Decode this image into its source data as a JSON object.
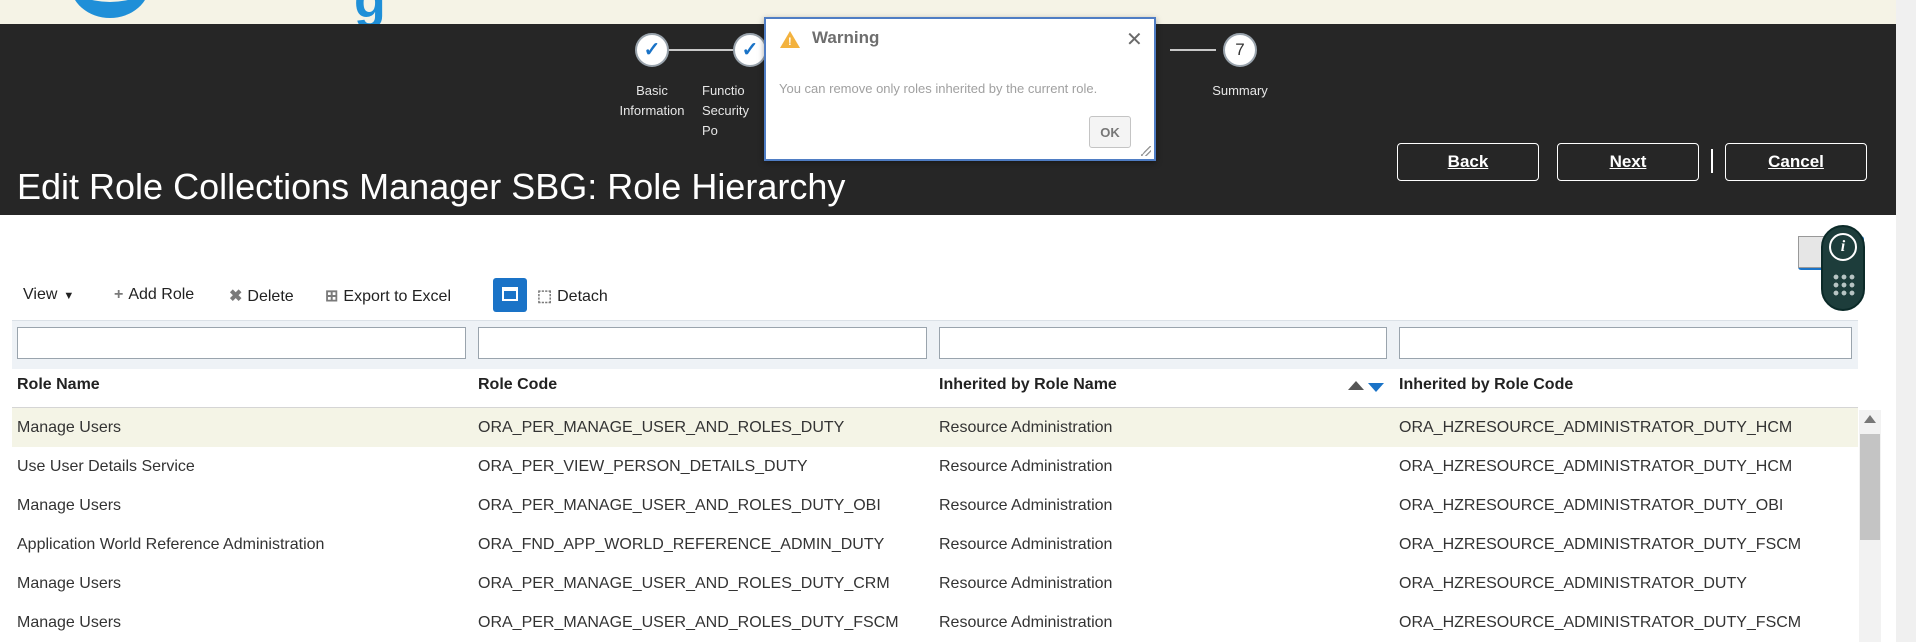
{
  "train": {
    "steps": [
      {
        "label_lines": [
          "Basic",
          "Information"
        ],
        "state": "done"
      },
      {
        "label_lines": [
          "Functio",
          "Security Po"
        ],
        "state": "done"
      },
      {
        "number": "7",
        "label_lines": [
          "Summary"
        ],
        "state": "pending"
      }
    ],
    "check_glyph": "✓"
  },
  "page": {
    "title": "Edit Role Collections Manager SBG: Role Hierarchy"
  },
  "header_buttons": {
    "back": "Back",
    "next": "Next",
    "cancel": "Cancel"
  },
  "dialog": {
    "title": "Warning",
    "message": "You can remove only roles inherited by the current role.",
    "ok_label": "OK",
    "close_glyph": "✕",
    "warn_glyph": "!"
  },
  "toolbar": {
    "view_label": "View",
    "view_caret": "▼",
    "add_role_label": "Add Role",
    "add_icon": "+",
    "delete_label": "Delete",
    "delete_icon": "✖",
    "export_label": "Export to Excel",
    "export_icon": "⊞",
    "detach_label": "Detach",
    "detach_icon": "⬚"
  },
  "assistant": {
    "info_glyph": "i"
  },
  "table": {
    "columns": [
      "Role Name",
      "Role Code",
      "Inherited by Role Name",
      "Inherited by Role Code"
    ],
    "rows": [
      [
        "Manage Users",
        "ORA_PER_MANAGE_USER_AND_ROLES_DUTY",
        "Resource Administration",
        "ORA_HZRESOURCE_ADMINISTRATOR_DUTY_HCM"
      ],
      [
        "Use User Details Service",
        "ORA_PER_VIEW_PERSON_DETAILS_DUTY",
        "Resource Administration",
        "ORA_HZRESOURCE_ADMINISTRATOR_DUTY_HCM"
      ],
      [
        "Manage Users",
        "ORA_PER_MANAGE_USER_AND_ROLES_DUTY_OBI",
        "Resource Administration",
        "ORA_HZRESOURCE_ADMINISTRATOR_DUTY_OBI"
      ],
      [
        "Application World Reference Administration",
        "ORA_FND_APP_WORLD_REFERENCE_ADMIN_DUTY",
        "Resource Administration",
        "ORA_HZRESOURCE_ADMINISTRATOR_DUTY_FSCM"
      ],
      [
        "Manage Users",
        "ORA_PER_MANAGE_USER_AND_ROLES_DUTY_CRM",
        "Resource Administration",
        "ORA_HZRESOURCE_ADMINISTRATOR_DUTY"
      ],
      [
        "Manage Users",
        "ORA_PER_MANAGE_USER_AND_ROLES_DUTY_FSCM",
        "Resource Administration",
        "ORA_HZRESOURCE_ADMINISTRATOR_DUTY_FSCM"
      ]
    ],
    "selected_row_index": 0
  },
  "colors": {
    "header_bg": "#262626",
    "accent": "#1a73c7",
    "warning": "#f3b23e",
    "selected_row": "#f4f4e6"
  }
}
